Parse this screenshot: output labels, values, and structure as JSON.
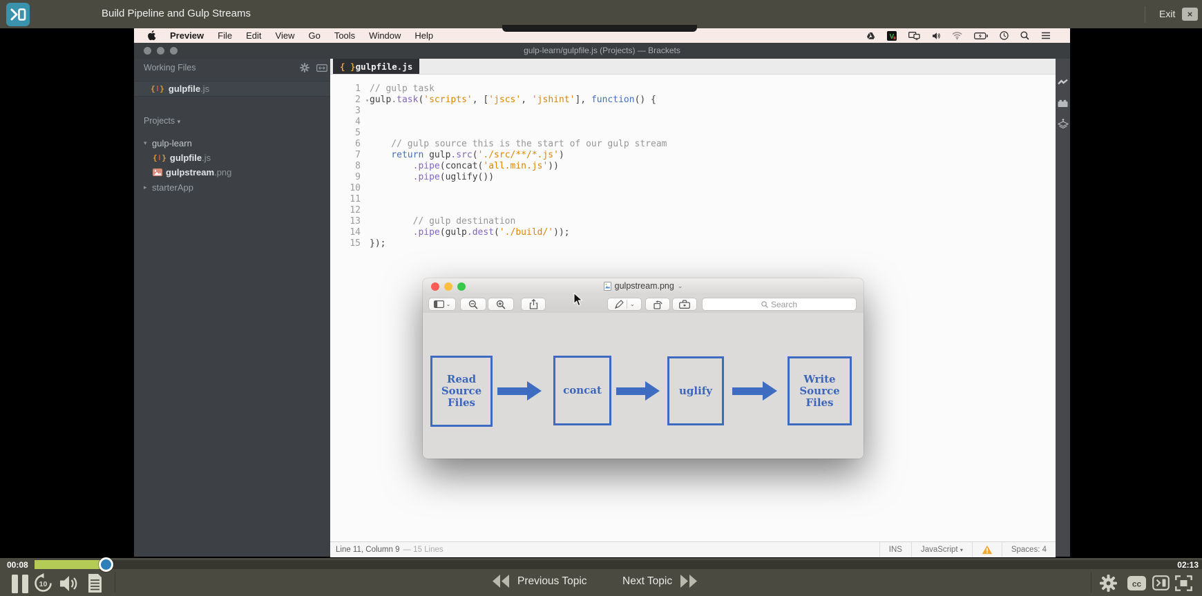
{
  "player": {
    "title": "Build Pipeline and Gulp Streams",
    "exit_label": "Exit",
    "exit_close_glyph": "×",
    "elapsed": "00:08",
    "duration": "02:13",
    "progress_percent": 6,
    "previous_label": "Previous Topic",
    "next_label": "Next Topic",
    "left_controls": [
      "pause",
      "rewind-10-seconds",
      "volume",
      "transcript"
    ],
    "right_controls": [
      "settings",
      "closed-captions",
      "theater-mode",
      "fullscreen"
    ],
    "colors": {
      "chrome": "#4a4a40",
      "logo_accent": "#3a92ad",
      "progress_fill": "#b4cb55",
      "progress_handle": "#2e7fb8"
    }
  },
  "macos": {
    "menu_items": [
      "Preview",
      "File",
      "Edit",
      "View",
      "Go",
      "Tools",
      "Window",
      "Help"
    ],
    "menubar_icons": [
      "google-drive",
      "v-app",
      "displays",
      "volume",
      "wifi",
      "battery",
      "clock",
      "spotlight-search",
      "notification-list"
    ]
  },
  "brackets": {
    "window_title": "gulp-learn/gulpfile.js (Projects) — Brackets",
    "working_files_label": "Working Files",
    "working_files": [
      {
        "name": "gulpfile",
        "ext": ".js"
      }
    ],
    "projects_label": "Projects",
    "project_tree": {
      "root": "gulp-learn",
      "children": [
        {
          "name": "gulpfile",
          "ext": ".js",
          "icon": "js-file"
        },
        {
          "name": "gulpstream",
          "ext": ".png",
          "icon": "image-file"
        }
      ],
      "sibling": "starterApp"
    },
    "tab": {
      "name": "gulpfile.js"
    },
    "statusbar": {
      "position": "Line 11, Column 9",
      "lines": "— 15 Lines",
      "ins": "INS",
      "language": "JavaScript",
      "spaces": "Spaces: 4"
    },
    "rail_icons": [
      "live-preview-bolt",
      "extension-brick",
      "layers-upload"
    ]
  },
  "editor": {
    "lines": [
      {
        "n": 1,
        "segs": [
          [
            "c",
            "// gulp task"
          ]
        ]
      },
      {
        "n": 2,
        "fold": true,
        "segs": [
          [
            "p",
            "gulp"
          ],
          [
            "m",
            ".task"
          ],
          [
            "p",
            "("
          ],
          [
            "s",
            "'scripts'"
          ],
          [
            "p",
            ", ["
          ],
          [
            "s",
            "'jscs'"
          ],
          [
            "p",
            ", "
          ],
          [
            "s",
            "'jshint'"
          ],
          [
            "p",
            "], "
          ],
          [
            "k",
            "function"
          ],
          [
            "p",
            "() {"
          ]
        ]
      },
      {
        "n": 3
      },
      {
        "n": 4
      },
      {
        "n": 5
      },
      {
        "n": 6,
        "segs": [
          [
            "c",
            "    // gulp source this is the start of our gulp stream"
          ]
        ]
      },
      {
        "n": 7,
        "segs": [
          [
            "k",
            "    return"
          ],
          [
            "p",
            " gulp"
          ],
          [
            "m",
            ".src"
          ],
          [
            "p",
            "("
          ],
          [
            "s",
            "'./src/**/*.js'"
          ],
          [
            "p",
            ")"
          ]
        ]
      },
      {
        "n": 8,
        "segs": [
          [
            "m",
            "        .pipe"
          ],
          [
            "p",
            "(concat("
          ],
          [
            "s",
            "'all.min.js'"
          ],
          [
            "p",
            "))"
          ]
        ]
      },
      {
        "n": 9,
        "segs": [
          [
            "m",
            "        .pipe"
          ],
          [
            "p",
            "(uglify())"
          ]
        ]
      },
      {
        "n": 10
      },
      {
        "n": 11
      },
      {
        "n": 12
      },
      {
        "n": 13,
        "segs": [
          [
            "c",
            "        // gulp destination"
          ]
        ]
      },
      {
        "n": 14,
        "segs": [
          [
            "m",
            "        .pipe"
          ],
          [
            "p",
            "(gulp"
          ],
          [
            "m",
            ".dest"
          ],
          [
            "p",
            "("
          ],
          [
            "s",
            "'./build/'"
          ],
          [
            "p",
            "));"
          ]
        ]
      },
      {
        "n": 15,
        "segs": [
          [
            "p",
            "});"
          ]
        ]
      }
    ]
  },
  "preview_window": {
    "title": "gulpstream.png",
    "search_placeholder": "Search",
    "toolbar_icons": [
      "sidebar-view",
      "zoom-out",
      "zoom-in",
      "share",
      "markup-pen",
      "rotate",
      "markup-toolbox",
      "search"
    ],
    "diagram": {
      "boxes": [
        "Read\nSource\nFiles",
        "concat",
        "uglify",
        "Write\nSource\nFiles"
      ],
      "box_color": "#3f6ac1"
    }
  }
}
